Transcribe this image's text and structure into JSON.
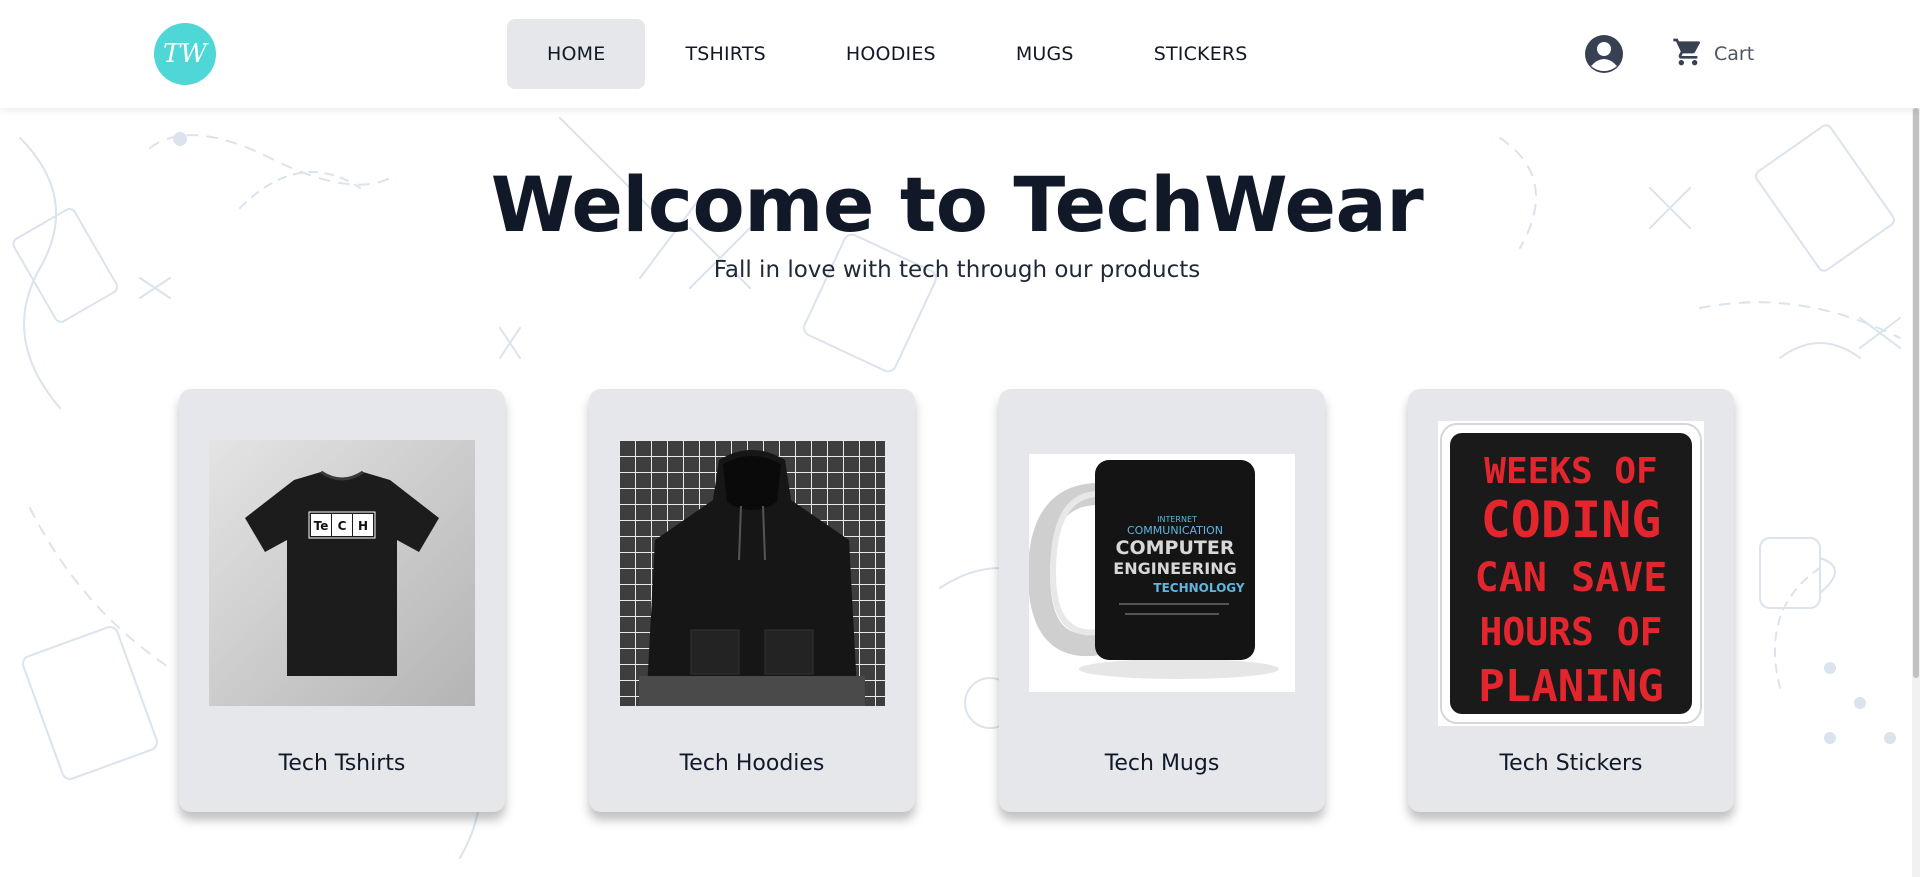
{
  "header": {
    "logo_text": "TW",
    "nav": [
      {
        "label": "HOME",
        "active": true
      },
      {
        "label": "TSHIRTS",
        "active": false
      },
      {
        "label": "HOODIES",
        "active": false
      },
      {
        "label": "MUGS",
        "active": false
      },
      {
        "label": "STICKERS",
        "active": false
      }
    ],
    "account_icon": "user-circle-icon",
    "cart_icon": "shopping-cart-icon",
    "cart_label": "Cart"
  },
  "hero": {
    "title": "Welcome to TechWear",
    "subtitle": "Fall in love with tech through our products"
  },
  "categories": [
    {
      "label": "Tech Tshirts",
      "image": "tshirt-product-image",
      "print": [
        "Te",
        "C",
        "H"
      ]
    },
    {
      "label": "Tech Hoodies",
      "image": "hoodie-product-image"
    },
    {
      "label": "Tech Mugs",
      "image": "mug-product-image",
      "print": [
        "COMPUTER",
        "ENGINEERING",
        "TECHNOLOGY",
        "COMMUNICATION",
        "INTERNET"
      ]
    },
    {
      "label": "Tech Stickers",
      "image": "sticker-product-image",
      "print": [
        "WEEKS OF",
        "CODING",
        "CAN SAVE",
        "HOURS OF",
        "PLANING"
      ]
    }
  ],
  "colors": {
    "brand": "#4fd6d6",
    "nav_active_bg": "#e5e7eb",
    "card_bg": "#e5e7eb",
    "text": "#111827",
    "sticker_red": "#e3262e"
  }
}
